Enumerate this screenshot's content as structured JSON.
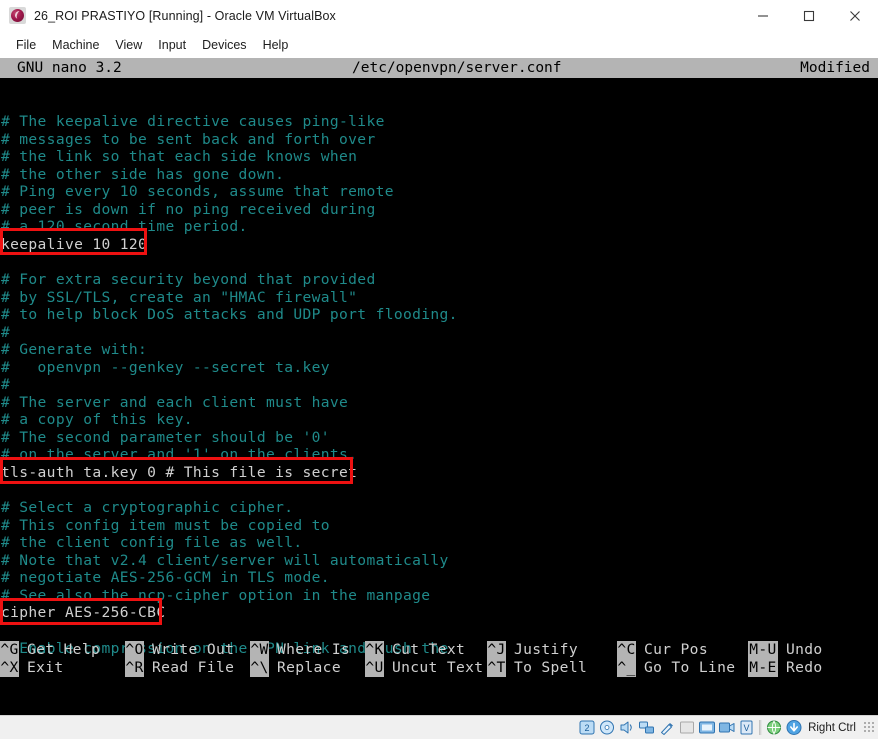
{
  "window": {
    "title": "26_ROI PRASTIYO [Running] - Oracle VM VirtualBox",
    "logo_icon": "virtualbox-logo-icon",
    "controls": {
      "minimize": "minimize-icon",
      "maximize": "maximize-icon",
      "close": "close-icon"
    }
  },
  "menubar": {
    "items": [
      {
        "label": "File"
      },
      {
        "label": "Machine"
      },
      {
        "label": "View"
      },
      {
        "label": "Input"
      },
      {
        "label": "Devices"
      },
      {
        "label": "Help"
      }
    ]
  },
  "nano": {
    "version_label": "GNU nano 3.2",
    "file_path": "/etc/openvpn/server.conf",
    "modified_label": "Modified",
    "lines": [
      {
        "text": "",
        "type": "blank"
      },
      {
        "text": "",
        "type": "blank"
      },
      {
        "text": "# The keepalive directive causes ping-like",
        "type": "comment"
      },
      {
        "text": "# messages to be sent back and forth over",
        "type": "comment"
      },
      {
        "text": "# the link so that each side knows when",
        "type": "comment"
      },
      {
        "text": "# the other side has gone down.",
        "type": "comment"
      },
      {
        "text": "# Ping every 10 seconds, assume that remote",
        "type": "comment"
      },
      {
        "text": "# peer is down if no ping received during",
        "type": "comment"
      },
      {
        "text": "# a 120 second time period.",
        "type": "comment"
      },
      {
        "text": "keepalive 10 120",
        "type": "code"
      },
      {
        "text": "",
        "type": "blank"
      },
      {
        "text": "# For extra security beyond that provided",
        "type": "comment"
      },
      {
        "text": "# by SSL/TLS, create an \"HMAC firewall\"",
        "type": "comment"
      },
      {
        "text": "# to help block DoS attacks and UDP port flooding.",
        "type": "comment"
      },
      {
        "text": "#",
        "type": "comment"
      },
      {
        "text": "# Generate with:",
        "type": "comment"
      },
      {
        "text": "#   openvpn --genkey --secret ta.key",
        "type": "comment"
      },
      {
        "text": "#",
        "type": "comment"
      },
      {
        "text": "# The server and each client must have",
        "type": "comment"
      },
      {
        "text": "# a copy of this key.",
        "type": "comment"
      },
      {
        "text": "# The second parameter should be '0'",
        "type": "comment"
      },
      {
        "text": "# on the server and '1' on the clients.",
        "type": "comment"
      },
      {
        "text": "tls-auth ta.key 0 # This file is secret",
        "type": "code"
      },
      {
        "text": "",
        "type": "blank"
      },
      {
        "text": "# Select a cryptographic cipher.",
        "type": "comment"
      },
      {
        "text": "# This config item must be copied to",
        "type": "comment"
      },
      {
        "text": "# the client config file as well.",
        "type": "comment"
      },
      {
        "text": "# Note that v2.4 client/server will automatically",
        "type": "comment"
      },
      {
        "text": "# negotiate AES-256-GCM in TLS mode.",
        "type": "comment"
      },
      {
        "text": "# See also the ncp-cipher option in the manpage",
        "type": "comment"
      },
      {
        "text": "cipher AES-256-CBC",
        "type": "code"
      },
      {
        "text": "",
        "type": "blank"
      },
      {
        "text": "# Enable compression on the VPN link and push the",
        "type": "comment"
      }
    ],
    "shortcuts_row1": [
      {
        "key": "^G",
        "label": "Get Help"
      },
      {
        "key": "^O",
        "label": "Write Out"
      },
      {
        "key": "^W",
        "label": "Where Is"
      },
      {
        "key": "^K",
        "label": "Cut Text"
      },
      {
        "key": "^J",
        "label": "Justify"
      },
      {
        "key": "^C",
        "label": "Cur Pos"
      },
      {
        "key": "M-U",
        "label": "Undo"
      }
    ],
    "shortcuts_row2": [
      {
        "key": "^X",
        "label": "Exit"
      },
      {
        "key": "^R",
        "label": "Read File"
      },
      {
        "key": "^\\",
        "label": "Replace"
      },
      {
        "key": "^U",
        "label": "Uncut Text"
      },
      {
        "key": "^T",
        "label": "To Spell"
      },
      {
        "key": "^_",
        "label": "Go To Line"
      },
      {
        "key": "M-E",
        "label": "Redo"
      }
    ]
  },
  "annotations": [
    {
      "target": "keepalive 10 120",
      "color": "#ee1111"
    },
    {
      "target": "tls-auth ta.key 0 # This file is secret",
      "color": "#ee1111"
    },
    {
      "target": "cipher AES-256-CBC",
      "color": "#ee1111"
    }
  ],
  "statusbar": {
    "icons": [
      "hard-disk-icon",
      "optical-disk-icon",
      "audio-icon",
      "network-icon",
      "usb-icon",
      "shared-folders-icon",
      "display-icon",
      "recording-icon",
      "vm-features-icon",
      "globe-icon",
      "mouse-integration-icon"
    ],
    "host_key_label": "Right Ctrl",
    "resize_grip": "resize-grip-icon"
  }
}
